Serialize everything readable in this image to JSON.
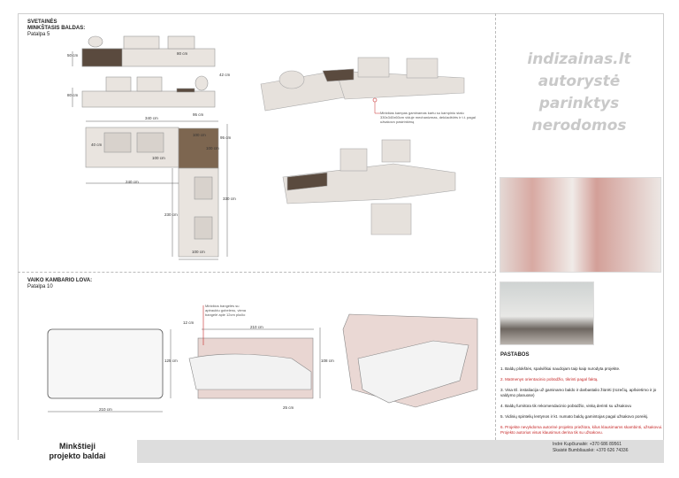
{
  "sections": {
    "living": {
      "title": "SVETAINĖS MINKŠTASIS BALDAS:",
      "room": "Patalpa 5"
    },
    "kids": {
      "title": "VAIKO KAMBARIO LOVA:",
      "room": "Patalpa 10"
    }
  },
  "living_dims": {
    "d50": "50 cm",
    "d80": "80 cm",
    "d42": "42 cm",
    "d80b": "80 cm",
    "d340": "340 cm",
    "d95": "95 cm",
    "d40": "40 cm",
    "d100a": "100 cm",
    "d100b": "100 cm",
    "d100c": "100 cm",
    "d95b": "95 cm",
    "d240": "240 cm",
    "d230": "230 cm",
    "d330": "330 cm",
    "d100d": "100 cm"
  },
  "living_callout": "Minkštas kampas gaminamas kartu su kampiniu stalu 330x340x60cm viduje mechanizmas, dekčadėžės ir t.t. pagal užsakovo pasirinkimą",
  "kids_dims": {
    "d210": "210 cm",
    "d125": "125 cm",
    "d12": "12 cm",
    "d210b": "210 cm",
    "d108": "108 cm",
    "d25": "25 cm"
  },
  "kids_callout": "Minkštos bangelės su aptrauktu gobelenu, viena bangelė apie 12cm pločio",
  "watermark": [
    "indizainas.lt",
    "autorystė",
    "parinktys",
    "nerodomos"
  ],
  "notes": {
    "heading": "PASTABOS",
    "items": [
      {
        "text": "1. Baldų plokštės, spalviškai naudojam taip kaip nurodyta projekte.",
        "color": "#222222"
      },
      {
        "text": "2. Matmenys orientacinio pobūdžio, tikrinti pagal faktą.",
        "color": "#c62828"
      },
      {
        "text": "3. Visa El. instaliacija už gaminamo baldo ir darbastalio žiūrėti (rozečių, apšvietimo ir jo valdymo planuose)",
        "color": "#222222"
      },
      {
        "text": "4. Baldų furnitūra tik rekomendacinio pobūdžio, viską derinti su užsakovu",
        "color": "#222222"
      },
      {
        "text": "5. Vidinių spintelių lentynos ir kt. numato baldų gamintojas pagal užsakovo poreikį.",
        "color": "#222222"
      },
      {
        "text": "6. Projekte nevykdoma autorinė projekto priežiūra, kilus klausimams skambinti, užsakovui. Projekto autorius visus klausimus derina tik su užsakovu.",
        "color": "#c62828"
      }
    ]
  },
  "footer": {
    "title_line1": "Minkštieji",
    "title_line2": "projekto baldai",
    "contact1": "Indrė Kupčiunaitė: +370 686 89561",
    "contact2": "Skaistė Bumbliauskė: +370 626 74336"
  }
}
